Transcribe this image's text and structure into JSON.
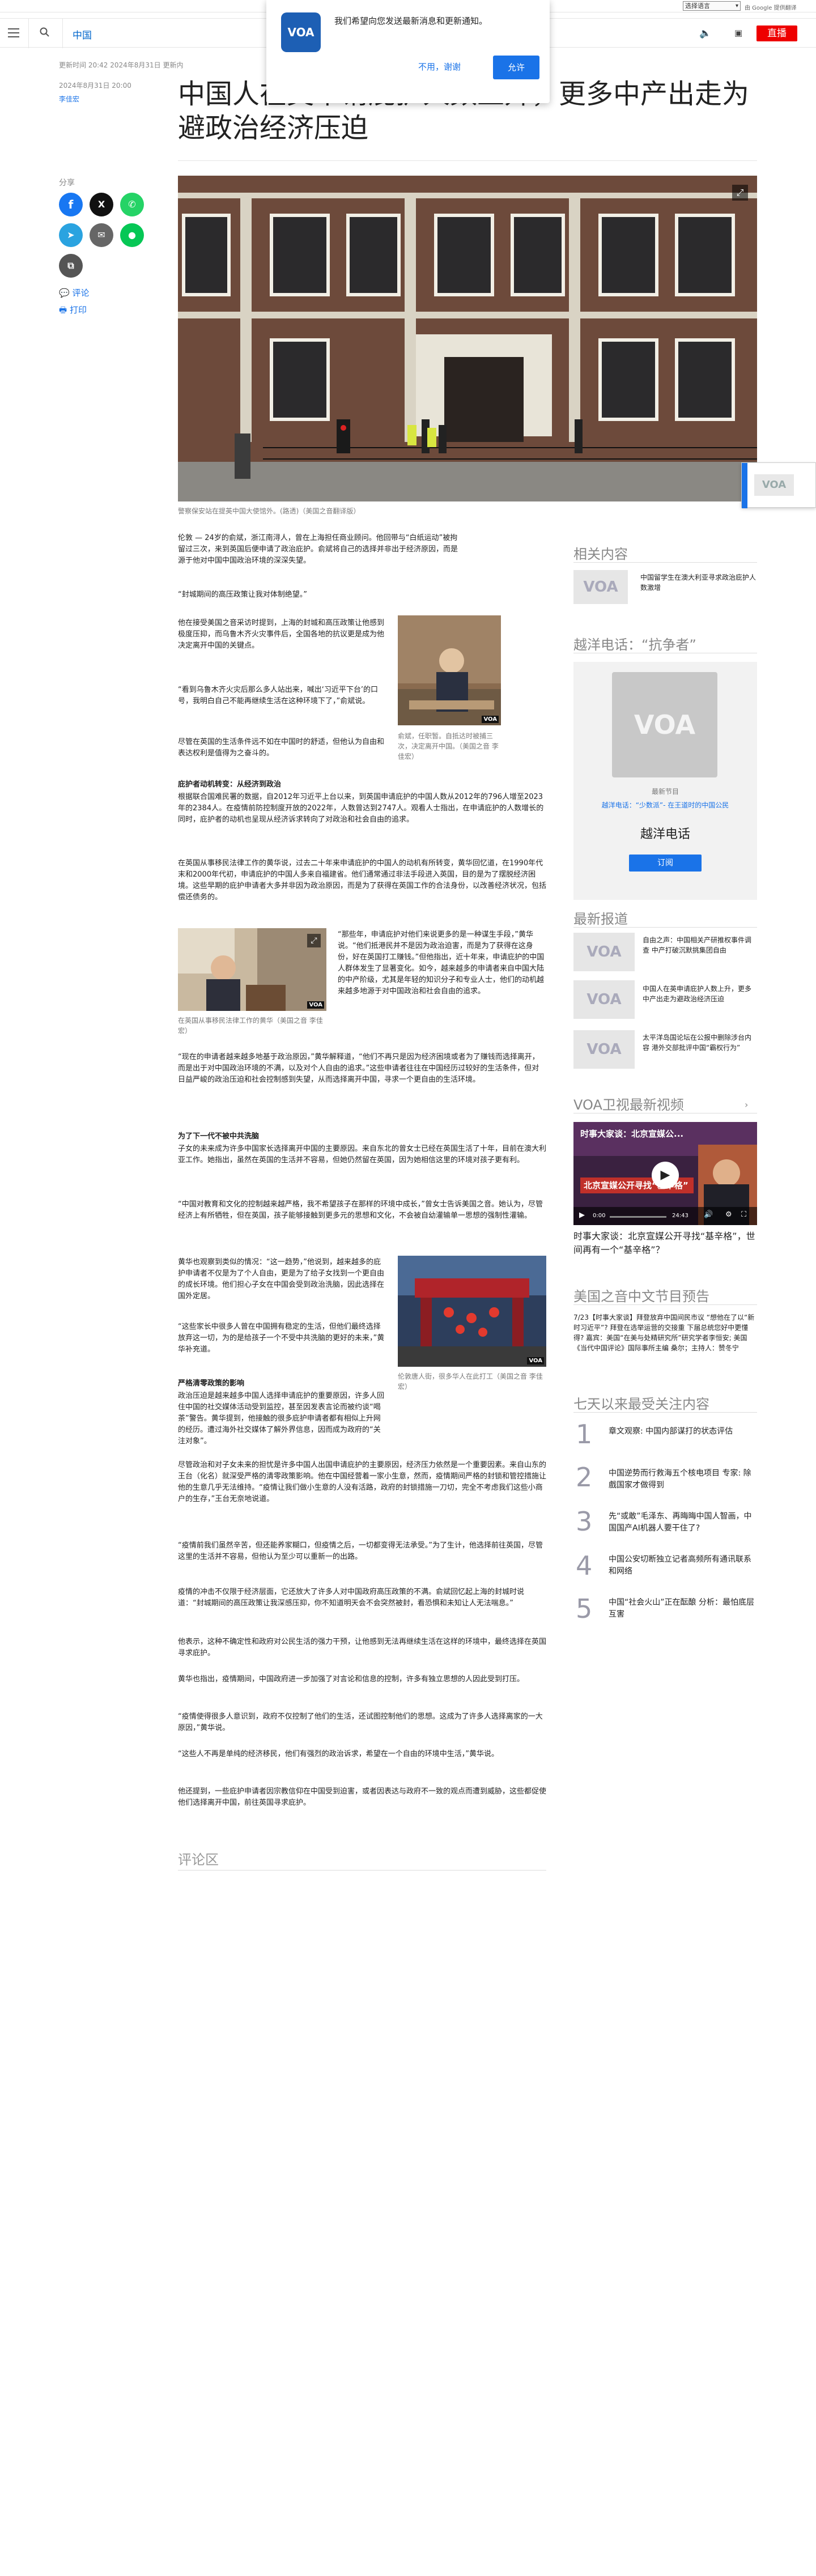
{
  "translate": {
    "select_label": "选择语言",
    "powered": "由 Google 提供翻译"
  },
  "topbar": {
    "lang": "中国",
    "live": "直播"
  },
  "notification": {
    "logo": "VOA",
    "message": "我们希望向您发送最新消息和更新通知。",
    "no": "不用，谢谢",
    "yes": "允许"
  },
  "article": {
    "timestamps": "更新时间 20:42 2024年8月31日 更新内",
    "date": "2024年8月31日 20:00",
    "author": "李佳宏",
    "title": "中国人在英申请庇护人数上升，更多中产出走为避政治经济压迫",
    "hero_caption": "警察保安站在提英中国大使馆外。(路透)（美国之音翻译版）",
    "paragraphs": [
      "伦敦 — 24岁的俞斌，浙江南浔人，曾在上海担任商业顾问。他回带与“白纸运动”被拘留过三次，来到英国后便申请了政治庇护。俞斌将自己的选择并非出于经济原因，而是源于他对中国中国政治环境的深深失望。",
      "“封城期间的高压政策让我对体制绝望。”",
      "他在接受美国之音采访时提到，上海的封城和高压政策让他感到极度压抑，而乌鲁木齐火灾事件后，全国各地的抗议更是成为他决定离开中国的关键点。",
      "“看到乌鲁木齐火灾后那么多人站出来，喊出‘习近平下台’的口号，我明白自己不能再继续生活在这种环境下了，”俞斌说。",
      "尽管在英国的生活条件远不如在中国时的舒适，但他认为自由和表达权利是值得为之奋斗的。",
      "庇护者动机转变：从经济到政治",
      "根据联合国难民署的数据，自2012年习近平上台以来，到英国申请庇护的中国人数从2012年的796人增至2023年的2384人。在疫情前防控制度开放的2022年，人数曾达到2747人。观看人士指出，在申请庇护的人数增长的同时，庇护者的动机也呈现从经济诉求转向了对政治和社会自由的追求。",
      "在英国从事移民法律工作的黄华说，过去二十年来申请庇护的中国人的动机有所转变，黄华回忆道，在1990年代末和2000年代初，申请庇护的中国人多来自福建省。他们通常通过非法手段进入英国，目的是为了摆脱经济困境。这些早期的庇护申请者大多并非因为政治原因，而是为了获得在英国工作的合法身份，以改善经济状况，包括偿还债务的。",
      "“那些年，申请庇护对他们来说更多的是一种谋生手段，”黄华说。“他们抵港民并不是因为政治迫害，而是为了获得在这身份，好在英国打工赚钱。”但他指出，近十年来，申请庇护的中国人群体发生了显著变化。如今，越来越多的申请者来自中国大陆的中产阶级，尤其是年轻的知识分子和专业人士，他们的动机越来越多地源于对中国政治和社会自由的追求。",
      "“现在的申请者越来越多地基于政治原因，”黄华解释道，“他们不再只是因为经济困境或者为了赚钱而选择离开，而是出于对中国政治环境的不满，以及对个人自由的追求。”这些申请者往往在中国经历过较好的生活条件，但对日益严峻的政治压迫和社会控制感到失望，从而选择离开中国，寻求一个更自由的生活环境。",
      "为了下一代不被中共洗脑",
      "子女的未来成为许多中国家长选择离开中国的主要原因。来自东北的曾女士已经在英国生活了十年，目前在澳大利亚工作。她指出，虽然在英国的生活并不容易，但她仍然留在英国，因为她相信这里的环境对孩子更有利。",
      "“中国对教育和文化的控制越来越严格，我不希望孩子在那样的环境中成长，”曾女士告诉美国之音。她认为，尽管经济上有所牺牲，但在英国，孩子能够接触到更多元的思想和文化，不会被自幼灌输单一思想的强制性灌输。",
      "黄华也观察到类似的情况：“这一趋势，”他说到，越来越多的庇护申请者不仅是为了个人自由，更是为了给子女找到一个更自由的成长环境。他们担心子女在中国会受到政治洗脑，因此选择在国外定居。",
      "“这些家长中很多人曾在中国拥有稳定的生活，但他们最终选择放弃这一切，为的是给孩子一个不受中共洗脑的更好的未来，”黄华补充道。",
      "严格清零政策的影响",
      "政治压迫是越来越多中国人选择申请庇护的重要原因，许多人回住中国的社交媒体活动受到监控，甚至因发表言论而被约谈“喝茶”警告。黄华提到，他接触的很多庇护申请者都有相似上升网的经历。遭过海外社交媒体了解外界信息，因而成为政府的“关注对象”。",
      "尽管政治和对子女未来的担忧是许多中国人出国申请庇护的主要原因，经济压力依然是一个重要因素。来自山东的王台（化名）就深受严格的清零政策影响。他在中国经营着一家小生意，然而，疫情期间严格的封锁和管控措施让他的生意几乎无法维持。“疫情让我们做小生意的人没有活路，政府的封锁措施一刀切，完全不考虑我们这些小商户的生存，”王台无奈地说道。",
      "“疫情前我们虽然辛苦，但还能养家糊口，但疫情之后，一切都变得无法承受。”为了生计，他选择前往英国，尽管这里的生活并不容易，但他认为至少可以重新一的出路。",
      "疫情的冲击不仅限于经济层面，它还放大了许多人对中国政府高压政策的不满。俞斌回忆起上海的封城时说道：“封城期间的高压政策让我深感压抑，你不知道明天会不会突然被封，看恐惧和未知让人无法喘息。”",
      "他表示，这种不确定性和政府对公民生活的强力干预，让他感到无法再继续生活在这样的环境中，最终选择在英国寻求庇护。",
      "黄华也指出，疫情期间，中国政府进一步加强了对言论和信息的控制，许多有独立思想的人因此受到打压。",
      "“疫情使得很多人意识到，政府不仅控制了他们的生活，还试图控制他们的思想。这成为了许多人选择离家的一大原因，”黄华说。",
      "“这些人不再是单纯的经济移民，他们有强烈的政治诉求，希望在一个自由的环境中生活，”黄华说。",
      "他还提到，一些庇护申请者因宗教信仰在中国受到迫害，或者因表达与政府不一致的观点而遭到威胁，这些都促使他们选择离开中国，前往英国寻求庇护。"
    ],
    "photo1_caption": "俞斌，任职暂。自抵达时被捕三次，决定离开中国。（美国之音 李佳宏）",
    "photo2_caption": "在英国从事移民法律工作的黄华（美国之音 李佳宏）",
    "photo3_caption": "伦敦唐人街，很多华人在此打工（美国之音 李佳宏）",
    "comments_label": "评论区"
  },
  "share": {
    "label": "分享",
    "comment": "评论",
    "print": "打印"
  },
  "right": {
    "related_title": "相关内容",
    "related_text": "中国留学生在澳大利亚寻求政治庇护人数激增",
    "hotline_title": "越洋电话：“抗争者”",
    "hotline_program_label": "最新节目",
    "hotline_program_link": "越洋电话：“少数派”- 在王道时的中国公民",
    "hotline_name": "越洋电话",
    "subscribe": "订阅",
    "latest_title": "最新报道",
    "latest": [
      "自由之声：中国相关产研推权事件调查 中产打破沉默挑集团自由",
      "中国人在英申请庇护人数上升，更多中产出走为避政治经济压迫",
      "太平洋岛国论坛在公报中删除涉台内容 港外交部批评中国“霸权行为”"
    ],
    "tv_title": "VOA卫视最新视频",
    "video_overlay": "时事大家谈：北京宣媒公...",
    "video_banner": "北京宣媒公开寻找“基辛格”",
    "video_time": "0:00",
    "video_duration": "24:43",
    "video_title": "时事大家谈：北京宣媒公开寻找“基辛格”，世间再有一个“基辛格”？",
    "preview_title": "美国之音中文节目预告",
    "preview_text": "7/23【时事大家谈】拜登放弃中国间民市议 “想他在了以“新时习近平”? 拜登在选举运营的交接重 下届总统您好中更懂得? 嘉宾：美国“在美与处精研究所”研究学者李恒安; 美国《当代中国评论》国际事所主编 桑尔；主持人：赞冬宁",
    "top_title": "七天以来最受关注内容",
    "top": [
      "章文观察: 中国内部谋打的状态评估",
      "中国逆势而行救海五个核电项目 专家: 除戲国家才做得到",
      "先“或敢”毛泽东、再晦晦中国人智画，中国国产AI机器人要干住了?",
      "中国公安切断独立记者高频所有通讯联系和网络",
      "中国“社会火山”正在酝酿 分析：最怕底层互害"
    ]
  }
}
